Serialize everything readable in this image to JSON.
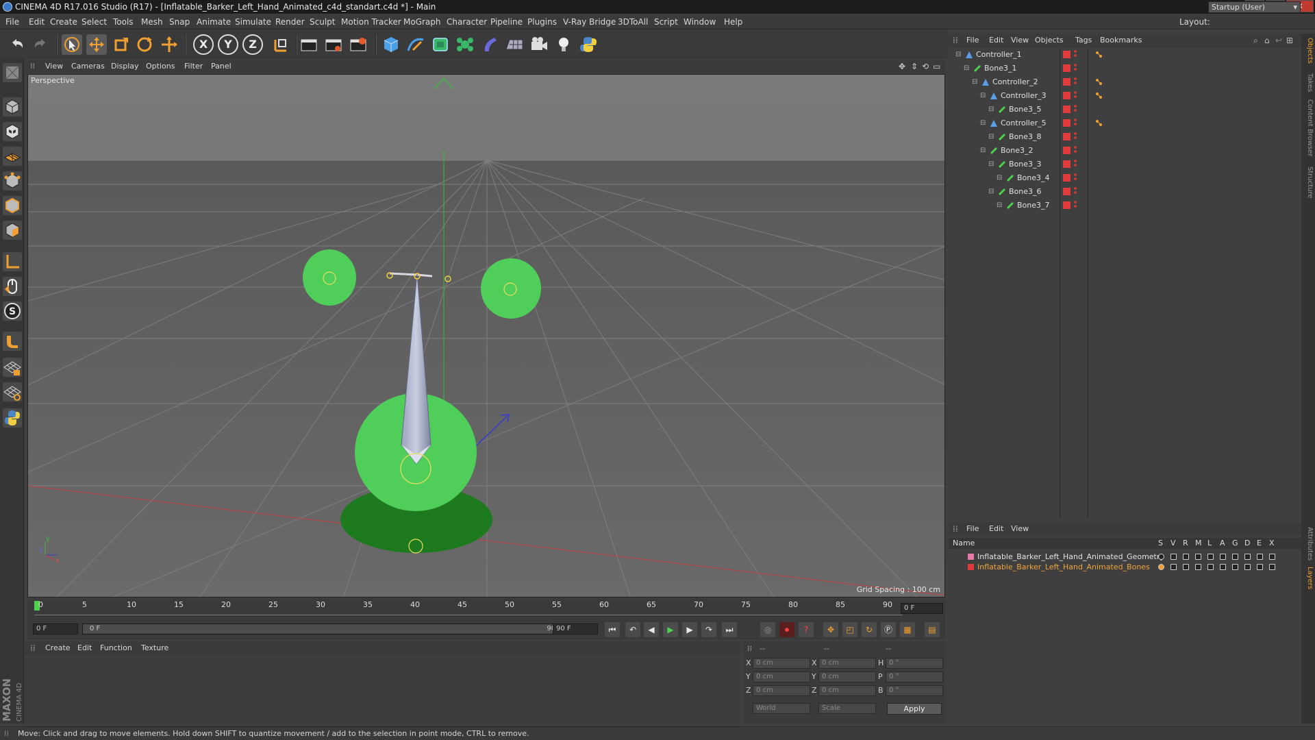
{
  "window": {
    "title": "CINEMA 4D R17.016 Studio (R17) - [Inflatable_Barker_Left_Hand_Animated_c4d_standart.c4d *] - Main",
    "minimize": "–",
    "maximize": "□",
    "close": "✕"
  },
  "menubar": {
    "items": [
      "File",
      "Edit",
      "Create",
      "Select",
      "Tools",
      "Mesh",
      "Snap",
      "Animate",
      "Simulate",
      "Render",
      "Sculpt",
      "Motion Tracker",
      "MoGraph",
      "Character",
      "Pipeline",
      "Plugins",
      "V-Ray Bridge",
      "3DToAll",
      "Script",
      "Window",
      "Help"
    ],
    "layout_label": "Layout:",
    "layout_value": "Startup (User)"
  },
  "toolbar": {
    "axis_x": "X",
    "axis_y": "Y",
    "axis_z": "Z"
  },
  "viewport": {
    "menu": [
      "View",
      "Cameras",
      "Display",
      "Options",
      "Filter",
      "Panel"
    ],
    "label": "Perspective",
    "grid_spacing": "Grid Spacing : 100 cm",
    "axis_y": "y",
    "axis_z": "z",
    "axis_x": "x"
  },
  "timeline": {
    "ticks": [
      "0",
      "5",
      "10",
      "15",
      "20",
      "25",
      "30",
      "35",
      "40",
      "45",
      "50",
      "55",
      "60",
      "65",
      "70",
      "75",
      "80",
      "85",
      "90"
    ],
    "current_frame": "0 F"
  },
  "transport": {
    "start_field": "0 F",
    "range_start": "0 F",
    "range_end": "90 F",
    "end_field": "90 F"
  },
  "materials": {
    "menu": [
      "Create",
      "Edit",
      "Function",
      "Texture"
    ]
  },
  "coordinates": {
    "headers": [
      "--",
      "--",
      "--"
    ],
    "rows": [
      {
        "l1": "X",
        "v1": "0 cm",
        "l2": "X",
        "v2": "0 cm",
        "l3": "H",
        "v3": "0 °"
      },
      {
        "l1": "Y",
        "v1": "0 cm",
        "l2": "Y",
        "v2": "0 cm",
        "l3": "P",
        "v3": "0 °"
      },
      {
        "l1": "Z",
        "v1": "0 cm",
        "l2": "Z",
        "v2": "0 cm",
        "l3": "B",
        "v3": "0 °"
      }
    ],
    "world": "World",
    "scale": "Scale",
    "apply": "Apply"
  },
  "status": {
    "text": "Move: Click and drag to move elements. Hold down SHIFT to quantize movement / add to the selection in point mode, CTRL to remove."
  },
  "maxon": {
    "brand": "MAXON",
    "product": "CINEMA 4D"
  },
  "object_manager": {
    "menu": [
      "File",
      "Edit",
      "View",
      "Objects",
      "Tags",
      "Bookmarks"
    ],
    "objects": [
      {
        "name": "Controller_1",
        "depth": 0,
        "kind": "controller",
        "tag": true
      },
      {
        "name": "Bone3_1",
        "depth": 1,
        "kind": "bone",
        "tag": false
      },
      {
        "name": "Controller_2",
        "depth": 2,
        "kind": "controller",
        "tag": true
      },
      {
        "name": "Controller_3",
        "depth": 3,
        "kind": "controller",
        "tag": true
      },
      {
        "name": "Bone3_5",
        "depth": 4,
        "kind": "bone",
        "tag": false
      },
      {
        "name": "Controller_5",
        "depth": 3,
        "kind": "controller",
        "tag": true
      },
      {
        "name": "Bone3_8",
        "depth": 4,
        "kind": "bone",
        "tag": false
      },
      {
        "name": "Bone3_2",
        "depth": 3,
        "kind": "bone",
        "tag": false
      },
      {
        "name": "Bone3_3",
        "depth": 4,
        "kind": "bone",
        "tag": false
      },
      {
        "name": "Bone3_4",
        "depth": 5,
        "kind": "bone",
        "tag": false
      },
      {
        "name": "Bone3_6",
        "depth": 4,
        "kind": "bone",
        "tag": false
      },
      {
        "name": "Bone3_7",
        "depth": 5,
        "kind": "bone",
        "tag": false
      }
    ]
  },
  "layer_manager": {
    "menu": [
      "File",
      "Edit",
      "View"
    ],
    "header_name": "Name",
    "columns": [
      "S",
      "V",
      "R",
      "M",
      "L",
      "A",
      "G",
      "D",
      "E",
      "X"
    ],
    "layers": [
      {
        "name": "Inflatable_Barker_Left_Hand_Animated_Geometry",
        "color": "#e57aa6",
        "text_color": "#e2e2e2"
      },
      {
        "name": "Inflatable_Barker_Left_Hand_Animated_Bones",
        "color": "#e03a3a",
        "text_color": "#f2a33a"
      }
    ]
  },
  "right_tabs": [
    "Objects",
    "Takes",
    "Content Browser",
    "Structure",
    "Attributes",
    "Layers"
  ],
  "colors": {
    "accent_green": "#4fcf5a",
    "dark_green": "#1e7a1e",
    "selection_orange": "#f0a030"
  }
}
